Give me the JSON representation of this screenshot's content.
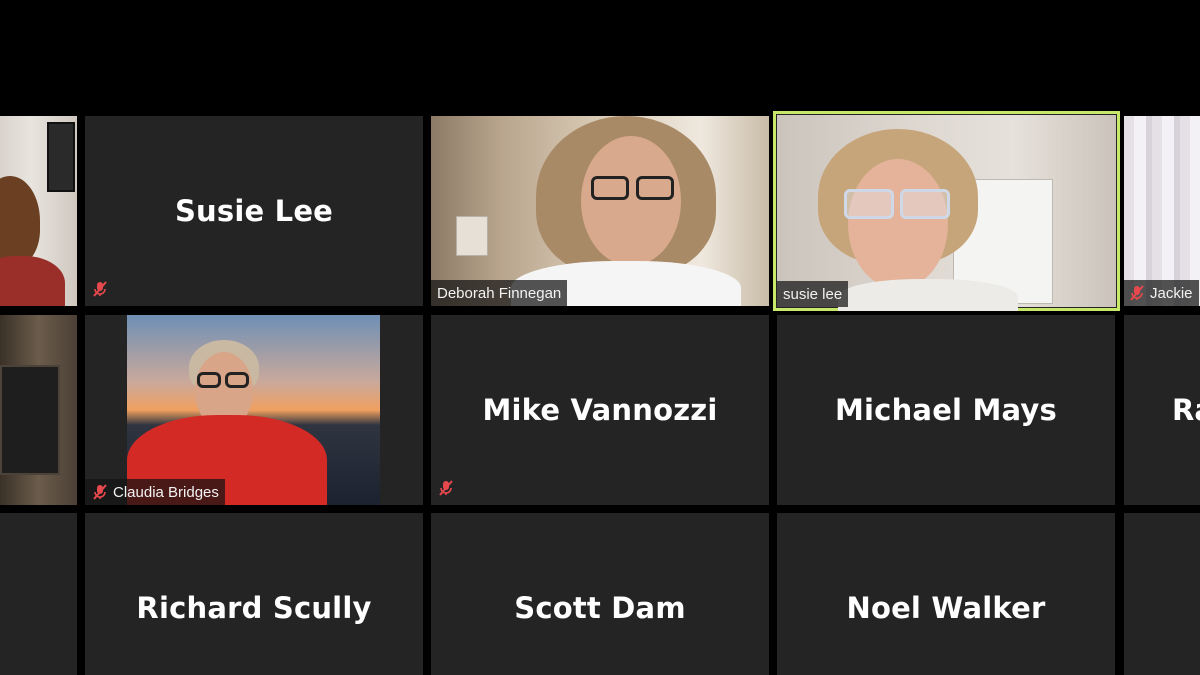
{
  "participants": {
    "row1": {
      "left_partial": {
        "muted": false
      },
      "susie_lee_tile": {
        "name": "Susie Lee",
        "muted": true
      },
      "deborah": {
        "name": "Deborah Finnegan",
        "muted": false
      },
      "susie_active": {
        "name": "susie lee",
        "muted": false,
        "active_speaker": true
      },
      "jackie": {
        "name": "Jackie",
        "muted": true
      }
    },
    "row2": {
      "left_partial": {
        "muted": false
      },
      "claudia": {
        "name": "Claudia Bridges",
        "muted": true
      },
      "mike": {
        "name": "Mike Vannozzi",
        "muted": true
      },
      "michael": {
        "name": "Michael Mays",
        "muted": false
      },
      "right_partial": {
        "name": "Ra"
      }
    },
    "row3": {
      "richard": {
        "name": "Richard Scully"
      },
      "scott": {
        "name": "Scott Dam"
      },
      "noel": {
        "name": "Noel Walker"
      }
    }
  },
  "colors": {
    "tile_bg": "#242424",
    "active_border": "#c8e86a",
    "mute_red": "#e5484d"
  },
  "icons": {
    "muted": "mic-muted-icon"
  }
}
